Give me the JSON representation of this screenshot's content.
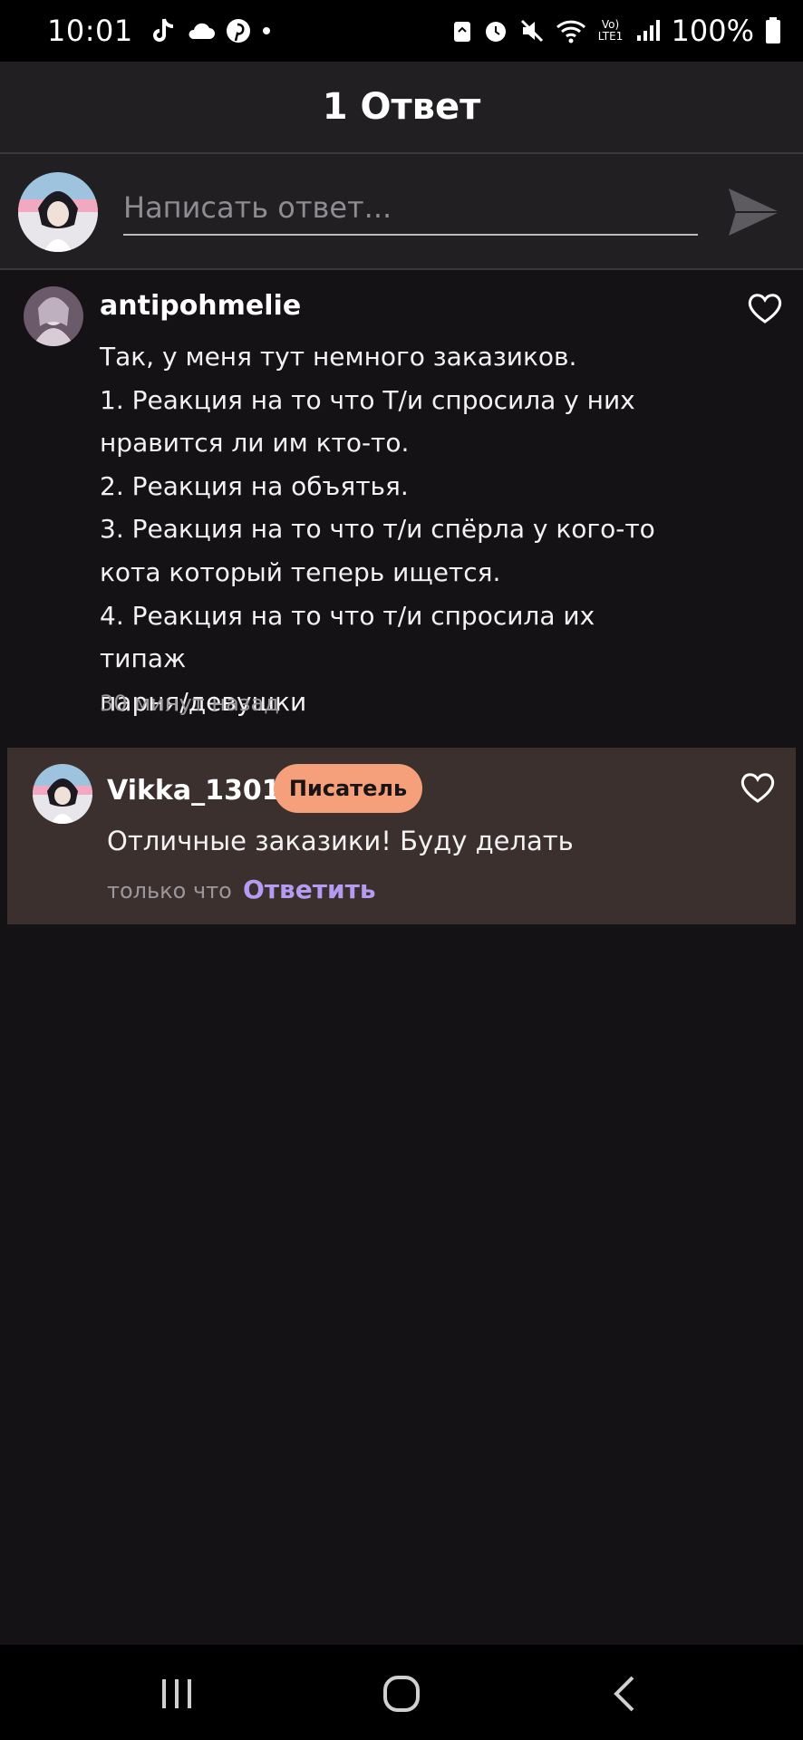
{
  "status_bar": {
    "time": "10:01",
    "battery": "100%",
    "left_icons": [
      "tiktok-icon",
      "cloud-icon",
      "pinterest-icon",
      "dot-icon"
    ],
    "right_icons": [
      "recycle-icon",
      "alarm-icon",
      "mute-icon",
      "wifi-icon",
      "volte-icon",
      "signal-icon",
      "battery-icon"
    ],
    "volte_label": "Vo) LTE1"
  },
  "header": {
    "title": "1 Ответ"
  },
  "reply_bar": {
    "placeholder": "Написать ответ..."
  },
  "comment": {
    "username": "antipohmelie",
    "lines": [
      "Так, у меня тут немного заказиков.",
      "1. Реакция на то что Т/и спросила у них",
      "нравится ли им кто-то.",
      "2. Реакция на объятья.",
      "3. Реакция на то что т/и спёрла у кого-то",
      "кота который теперь ищется.",
      "4. Реакция на то что т/и спросила их типаж",
      "парня/девушки"
    ],
    "time": "30 минут назад"
  },
  "reply": {
    "username": "Vikka_1301",
    "badge": "Писатель",
    "text": "Отличные заказики! Буду делать",
    "time": "только что",
    "reply_label": "Ответить"
  },
  "colors": {
    "background": "#141215",
    "header": "#211f22",
    "reply_card": "#3b302d",
    "badge": "#f5a07a",
    "accent_link": "#b59cf2"
  },
  "nav_bar": {
    "buttons": [
      "recent-apps-icon",
      "home-icon",
      "back-icon"
    ]
  }
}
